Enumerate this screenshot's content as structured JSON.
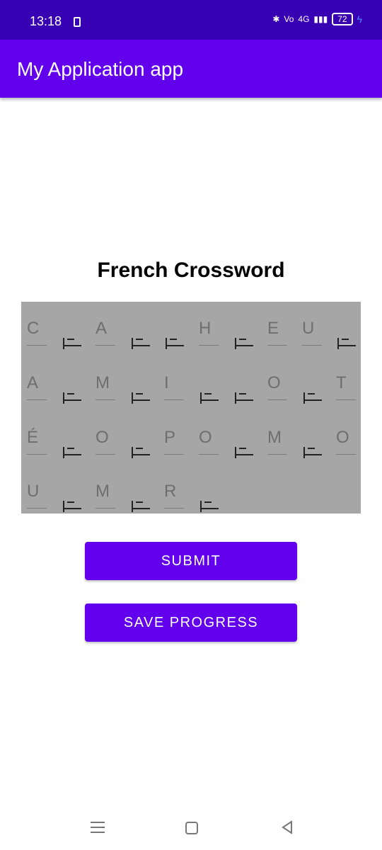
{
  "status_bar": {
    "time": "13:18",
    "battery": "72",
    "network_label": "4G"
  },
  "app_bar": {
    "title": "My Application app"
  },
  "page_title": "French Crossword",
  "crossword_rows": [
    [
      "C",
      "",
      "A",
      "",
      "",
      "H",
      "",
      "E",
      "U",
      ""
    ],
    [
      "A",
      "",
      "M",
      "",
      "I",
      "",
      "",
      "O",
      "",
      "T"
    ],
    [
      "É",
      "",
      "O",
      "",
      "P",
      "O",
      "",
      "M",
      "",
      "O"
    ],
    [
      "U",
      "",
      "M",
      "",
      "R",
      ""
    ]
  ],
  "buttons": {
    "submit": "SUBMIT",
    "save_progress": "SAVE PROGRESS"
  }
}
